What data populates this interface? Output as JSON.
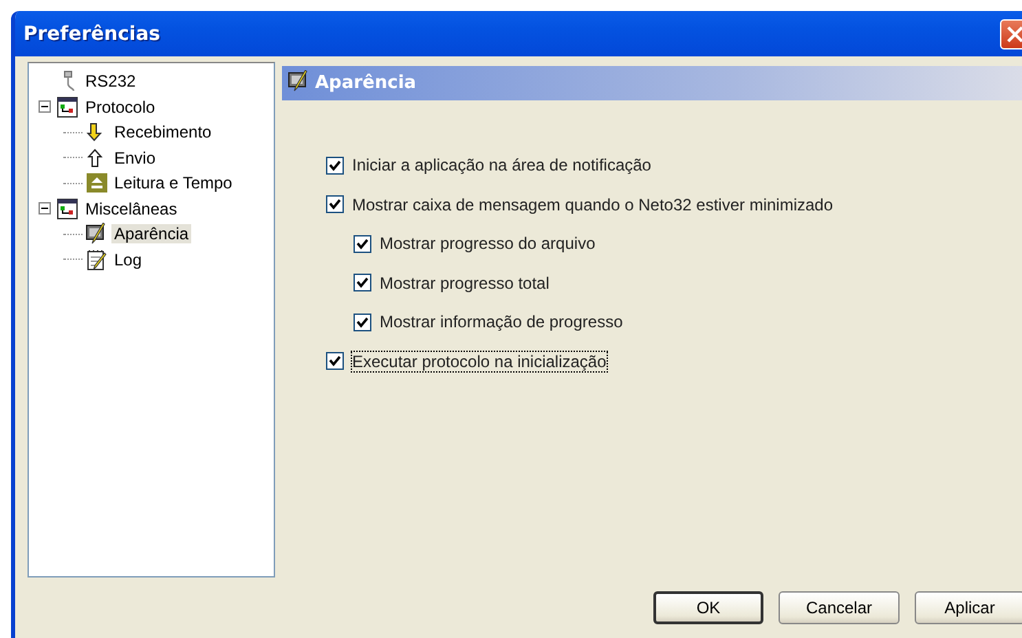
{
  "window": {
    "title": "Preferências"
  },
  "tree": [
    {
      "label": "RS232",
      "kind": "cable",
      "selected": false
    },
    {
      "label": "Protocolo",
      "kind": "tree",
      "selected": false,
      "expanded": true,
      "children": [
        {
          "label": "Recebimento",
          "kind": "down",
          "selected": false
        },
        {
          "label": "Envio",
          "kind": "up",
          "selected": false
        },
        {
          "label": "Leitura e Tempo",
          "kind": "eject",
          "selected": false
        }
      ]
    },
    {
      "label": "Miscelâneas",
      "kind": "tree",
      "selected": false,
      "expanded": true,
      "children": [
        {
          "label": "Aparência",
          "kind": "paint",
          "selected": true
        },
        {
          "label": "Log",
          "kind": "note",
          "selected": false
        }
      ]
    }
  ],
  "panel": {
    "title": "Aparência"
  },
  "options": [
    {
      "label": "Iniciar a aplicação na área de notificação",
      "checked": true,
      "focused": false
    },
    {
      "label": "Mostrar caixa de mensagem quando o Neto32 estiver minimizado",
      "checked": true,
      "focused": false,
      "children": [
        {
          "label": "Mostrar progresso do arquivo",
          "checked": true,
          "focused": false
        },
        {
          "label": "Mostrar progresso total",
          "checked": true,
          "focused": false
        },
        {
          "label": "Mostrar informação de progresso",
          "checked": true,
          "focused": false
        }
      ]
    },
    {
      "label": "Executar protocolo na inicialização",
      "checked": true,
      "focused": true
    }
  ],
  "buttons": [
    {
      "label": "OK",
      "default": true
    },
    {
      "label": "Cancelar",
      "default": false
    },
    {
      "label": "Aplicar",
      "default": false
    }
  ]
}
